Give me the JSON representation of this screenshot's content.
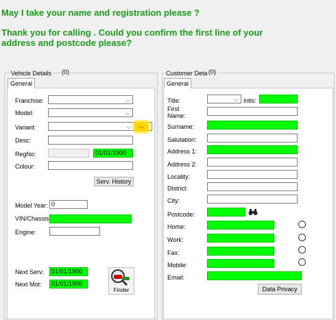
{
  "prompts": {
    "line1": "May I take your name and registration please ?",
    "line2": "Thank you for calling . Could you confirm the first line of your address and postcode please?"
  },
  "vehicle": {
    "group_title": "Vehicle Details",
    "count": "(0)",
    "tab": "General",
    "franchise_label": "Franchise:",
    "model_label": "Model:",
    "variant_label": "Variant:",
    "variant_button": "...",
    "desc_label": "Desc:",
    "regno_label": "RegNo:",
    "regno_date": "01/01/1900",
    "colour_label": "Colour:",
    "serv_history_button": "Serv. History",
    "model_year_label": "Model Year:",
    "model_year_value": "0",
    "vin_label": "VIN/Chassis",
    "engine_label": "Engine:",
    "next_serv_label": "Next Serv:",
    "next_serv_value": "01/01/1900",
    "next_mot_label": "Next Mot:",
    "next_mot_value": "01/01/1900",
    "finder_label": "Finder"
  },
  "customer": {
    "group_title": "Customer Detail:",
    "count": "(0)",
    "tab": "General",
    "title_label": "Title:",
    "intls_label": "Intls:",
    "first_name_label": "First Name:",
    "surname_label": "Surname:",
    "salutation_label": "Salutation:",
    "address1_label": "Address 1:",
    "address2_label": "Address 2:",
    "locality_label": "Locality:",
    "district_label": "District:",
    "city_label": "City:",
    "postcode_label": "Postcode:",
    "home_label": "Home:",
    "work_label": "Work:",
    "fax_label": "Fax:",
    "mobile_label": "Mobile:",
    "email_label": "Email:",
    "data_privacy_button": "Data Privacy"
  }
}
